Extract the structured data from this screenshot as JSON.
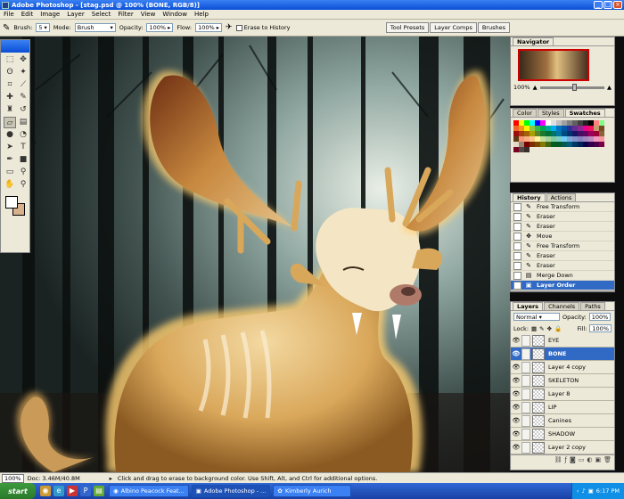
{
  "window": {
    "title": "Adobe Photoshop - [stag.psd @ 100% (BONE, RGB/8)]"
  },
  "menu": [
    "File",
    "Edit",
    "Image",
    "Layer",
    "Select",
    "Filter",
    "View",
    "Window",
    "Help"
  ],
  "options": {
    "brush_label": "Brush:",
    "brush_size": "5",
    "mode_label": "Mode:",
    "mode_value": "Brush",
    "opacity_label": "Opacity:",
    "opacity_value": "100%",
    "flow_label": "Flow:",
    "flow_value": "100%",
    "erase_history": "Erase to History",
    "palette_well": [
      "Tool Presets",
      "Layer Comps",
      "Brushes"
    ]
  },
  "toolbox": {
    "tools": [
      "marquee-icon",
      "move-icon",
      "lasso-icon",
      "magic-wand-icon",
      "crop-icon",
      "slice-icon",
      "healing-icon",
      "brush-icon",
      "stamp-icon",
      "history-brush-icon",
      "eraser-icon",
      "gradient-icon",
      "blur-icon",
      "dodge-icon",
      "path-select-icon",
      "type-icon",
      "pen-icon",
      "shape-icon",
      "notes-icon",
      "eyedropper-icon",
      "hand-icon",
      "zoom-icon"
    ],
    "foreground_color": "#ffffff",
    "background_color": "#d9b08c"
  },
  "navigator": {
    "tab": "Navigator",
    "zoom": "100%",
    "zoom_level": 0.5
  },
  "color_panel": {
    "tabs": [
      "Color",
      "Styles",
      "Swatches"
    ],
    "swatches": [
      "#ff0000",
      "#ffff00",
      "#00ff00",
      "#00ffff",
      "#0000ff",
      "#ff00ff",
      "#ffffff",
      "#e0e0e0",
      "#c0c0c0",
      "#a0a0a0",
      "#808080",
      "#606060",
      "#404040",
      "#202020",
      "#000000",
      "#ff8080",
      "#80ff80",
      "#f26522",
      "#f7941d",
      "#fff200",
      "#8dc63f",
      "#39b54a",
      "#00a651",
      "#00a99d",
      "#00aeef",
      "#0072bc",
      "#0054a6",
      "#2e3192",
      "#662d91",
      "#92278f",
      "#ec008c",
      "#ed145b",
      "#c69c6d",
      "#754c24",
      "#9e0b0f",
      "#a0410d",
      "#a36209",
      "#aba000",
      "#598527",
      "#1a7b30",
      "#007236",
      "#00746b",
      "#0076a3",
      "#004b80",
      "#003471",
      "#1b1464",
      "#440e62",
      "#630460",
      "#9e005d",
      "#9e0039",
      "#8c6239",
      "#603913",
      "#f69679",
      "#f9ad81",
      "#fdc68a",
      "#fff79a",
      "#c4df9b",
      "#a3d39c",
      "#82ca9d",
      "#7bcdc8",
      "#6ecff6",
      "#7ea7d8",
      "#8393ca",
      "#8781bd",
      "#a187be",
      "#bd8cbf",
      "#f49ac2",
      "#f6989d",
      "#e3d7c5",
      "#998675",
      "#790000",
      "#7b2e00",
      "#7d4900",
      "#827b00",
      "#406618",
      "#005e20",
      "#005826",
      "#005952",
      "#005b7f",
      "#003663",
      "#002157",
      "#0d004c",
      "#32004b",
      "#4b0049",
      "#7b0046",
      "#7a0026",
      "#534741",
      "#362f2d"
    ]
  },
  "history": {
    "tabs": [
      "History",
      "Actions"
    ],
    "items": [
      {
        "label": "Free Transform",
        "icon": "transform-icon"
      },
      {
        "label": "Eraser",
        "icon": "eraser-icon"
      },
      {
        "label": "Eraser",
        "icon": "eraser-icon"
      },
      {
        "label": "Move",
        "icon": "move-icon"
      },
      {
        "label": "Free Transform",
        "icon": "transform-icon"
      },
      {
        "label": "Eraser",
        "icon": "eraser-icon"
      },
      {
        "label": "Eraser",
        "icon": "eraser-icon"
      },
      {
        "label": "Merge Down",
        "icon": "merge-icon"
      },
      {
        "label": "Layer Order",
        "icon": "layer-order-icon",
        "selected": true
      }
    ]
  },
  "layers": {
    "tabs": [
      "Layers",
      "Channels",
      "Paths"
    ],
    "blend_mode": "Normal",
    "opacity_label": "Opacity:",
    "opacity_value": "100%",
    "lock_label": "Lock:",
    "fill_label": "Fill:",
    "fill_value": "100%",
    "items": [
      {
        "name": "EYE"
      },
      {
        "name": "BONE",
        "selected": true
      },
      {
        "name": "Layer 4 copy"
      },
      {
        "name": "SKELETON"
      },
      {
        "name": "Layer 8"
      },
      {
        "name": "LIP"
      },
      {
        "name": "Canines"
      },
      {
        "name": "SHADOW"
      },
      {
        "name": "Layer 2 copy"
      }
    ]
  },
  "status": {
    "zoom": "100%",
    "doc": "Doc: 3.46M/40.8M",
    "hint": "Click and drag to erase to background color.  Use Shift, Alt, and Ctrl for additional options."
  },
  "taskbar": {
    "start": "start",
    "tasks": [
      "Albino Peacock Feat...",
      "Adobe Photoshop - ...",
      "Kimberly Aurich"
    ],
    "clock": "6:17 PM"
  }
}
